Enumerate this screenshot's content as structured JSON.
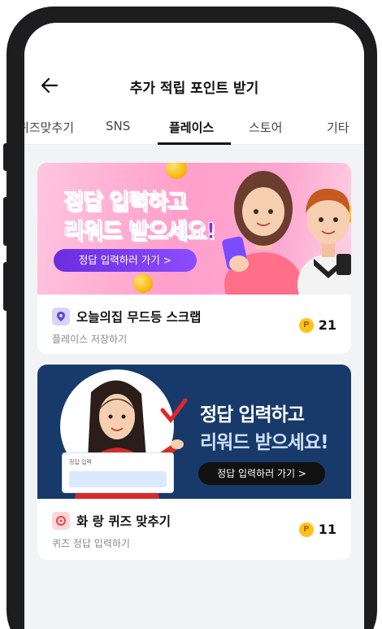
{
  "header": {
    "title": "추가 적립 포인트 받기"
  },
  "tabs": [
    {
      "label": "퀴즈맞추기"
    },
    {
      "label": "SNS"
    },
    {
      "label": "플레이스",
      "active": true
    },
    {
      "label": "스토어"
    },
    {
      "label": "기타"
    }
  ],
  "cards": [
    {
      "banner_line1": "정답 입력하고",
      "banner_line2": "리워드 받으세요!",
      "cta": "정답 입력하러 가기 >",
      "title": "오늘의집 무드등 스크랩",
      "subtitle": "플레이스 저장하기",
      "point_symbol": "P",
      "points": "21"
    },
    {
      "banner_line1": "정답 입력하고",
      "banner_line2": "리워드 받으세요!",
      "cta": "정답 입력하러 가기 >",
      "answer_label": "정답 입력",
      "title": "화 랑 퀴즈 맞추기",
      "subtitle": "퀴즈 정답 입력하기",
      "point_symbol": "P",
      "points": "11"
    }
  ],
  "colors": {
    "accent_purple": "#7b3cf0",
    "banner_pink": "#ff9fcb",
    "banner_navy": "#173a6a",
    "point_gold": "#ffc21a"
  },
  "icons": {
    "back": "arrow-left-icon",
    "place": "place-pin-icon",
    "quiz": "quiz-icon",
    "coin": "point-coin-icon"
  }
}
